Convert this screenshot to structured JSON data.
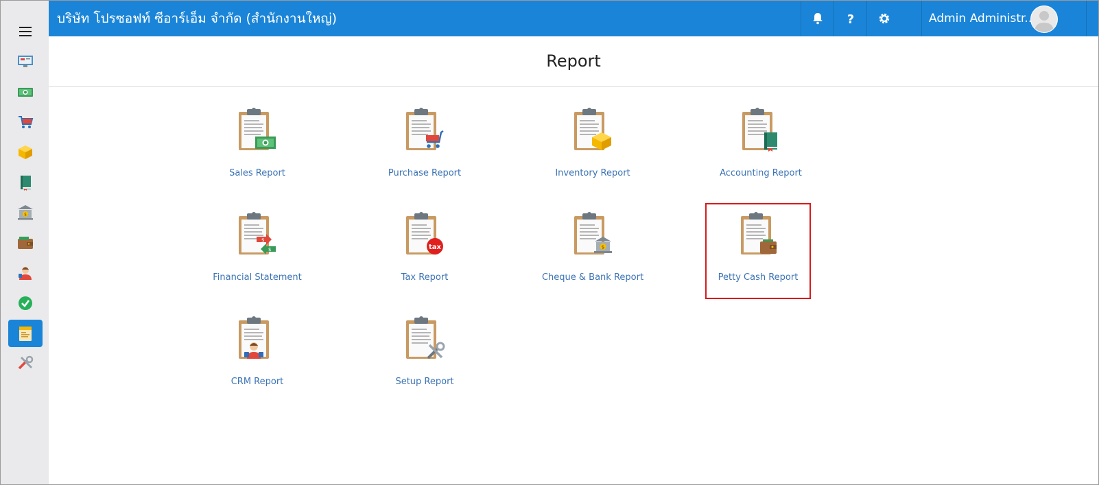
{
  "header": {
    "company_name": "บริษัท โปรซอฟท์ ซีอาร์เอ็ม จำกัด (สำนักงานใหญ่)",
    "user_name": "Admin Administr..."
  },
  "page": {
    "title": "Report"
  },
  "sidebar": {
    "items": [
      {
        "icon": "dashboard-icon"
      },
      {
        "icon": "money-icon"
      },
      {
        "icon": "cart-icon"
      },
      {
        "icon": "box-icon"
      },
      {
        "icon": "book-icon"
      },
      {
        "icon": "bank-icon"
      },
      {
        "icon": "wallet-icon"
      },
      {
        "icon": "people-icon"
      },
      {
        "icon": "check-icon"
      },
      {
        "icon": "report-icon",
        "active": true
      },
      {
        "icon": "tools-icon"
      }
    ]
  },
  "reports": [
    {
      "label": "Sales Report",
      "badge": "money"
    },
    {
      "label": "Purchase Report",
      "badge": "cart"
    },
    {
      "label": "Inventory Report",
      "badge": "box"
    },
    {
      "label": "Accounting Report",
      "badge": "book"
    },
    {
      "label": "Financial Statement",
      "badge": "exchange"
    },
    {
      "label": "Tax Report",
      "badge": "tax",
      "badge_text": "tax"
    },
    {
      "label": "Cheque & Bank Report",
      "badge": "bank"
    },
    {
      "label": "Petty Cash Report",
      "badge": "wallet",
      "selected": true
    },
    {
      "label": "CRM Report",
      "badge": "people"
    },
    {
      "label": "Setup Report",
      "badge": "tools"
    }
  ],
  "colors": {
    "primary": "#1a85d8",
    "highlight": "#d81a1a",
    "link": "#3b73b5"
  }
}
